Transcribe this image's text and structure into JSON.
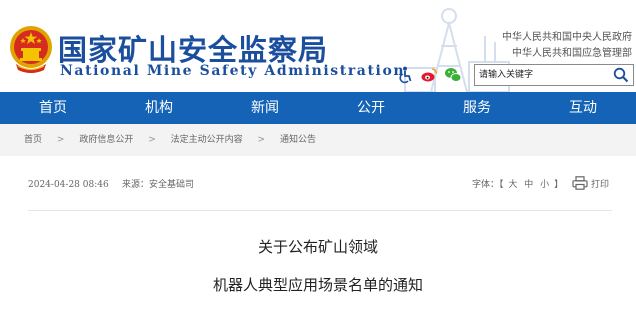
{
  "header": {
    "title_cn": "国家矿山安全监察局",
    "title_en": "National Mine Safety Administration",
    "org_links": [
      "中华人民共和国中央人民政府",
      "中华人民共和国应急管理部"
    ],
    "tool_icons": [
      "accessibility-icon",
      "weibo-icon",
      "wechat-icon"
    ],
    "search_placeholder": "请输入关键字",
    "brand_color": "#1b4f9e"
  },
  "nav": {
    "items": [
      "首页",
      "机构",
      "新闻",
      "公开",
      "服务",
      "互动"
    ],
    "background": "#1463b6"
  },
  "breadcrumb": [
    "首页",
    "政府信息公开",
    "法定主动公开内容",
    "通知公告"
  ],
  "article": {
    "date": "2024-04-28 08:46",
    "source": "来源：安全基础司",
    "font_label": "字体：【",
    "font_sizes": [
      "大",
      "中",
      "小"
    ],
    "font_close": "】",
    "print_label": "打印",
    "title_line1": "关于公布矿山领域",
    "title_line2": "机器人典型应用场景名单的通知"
  }
}
